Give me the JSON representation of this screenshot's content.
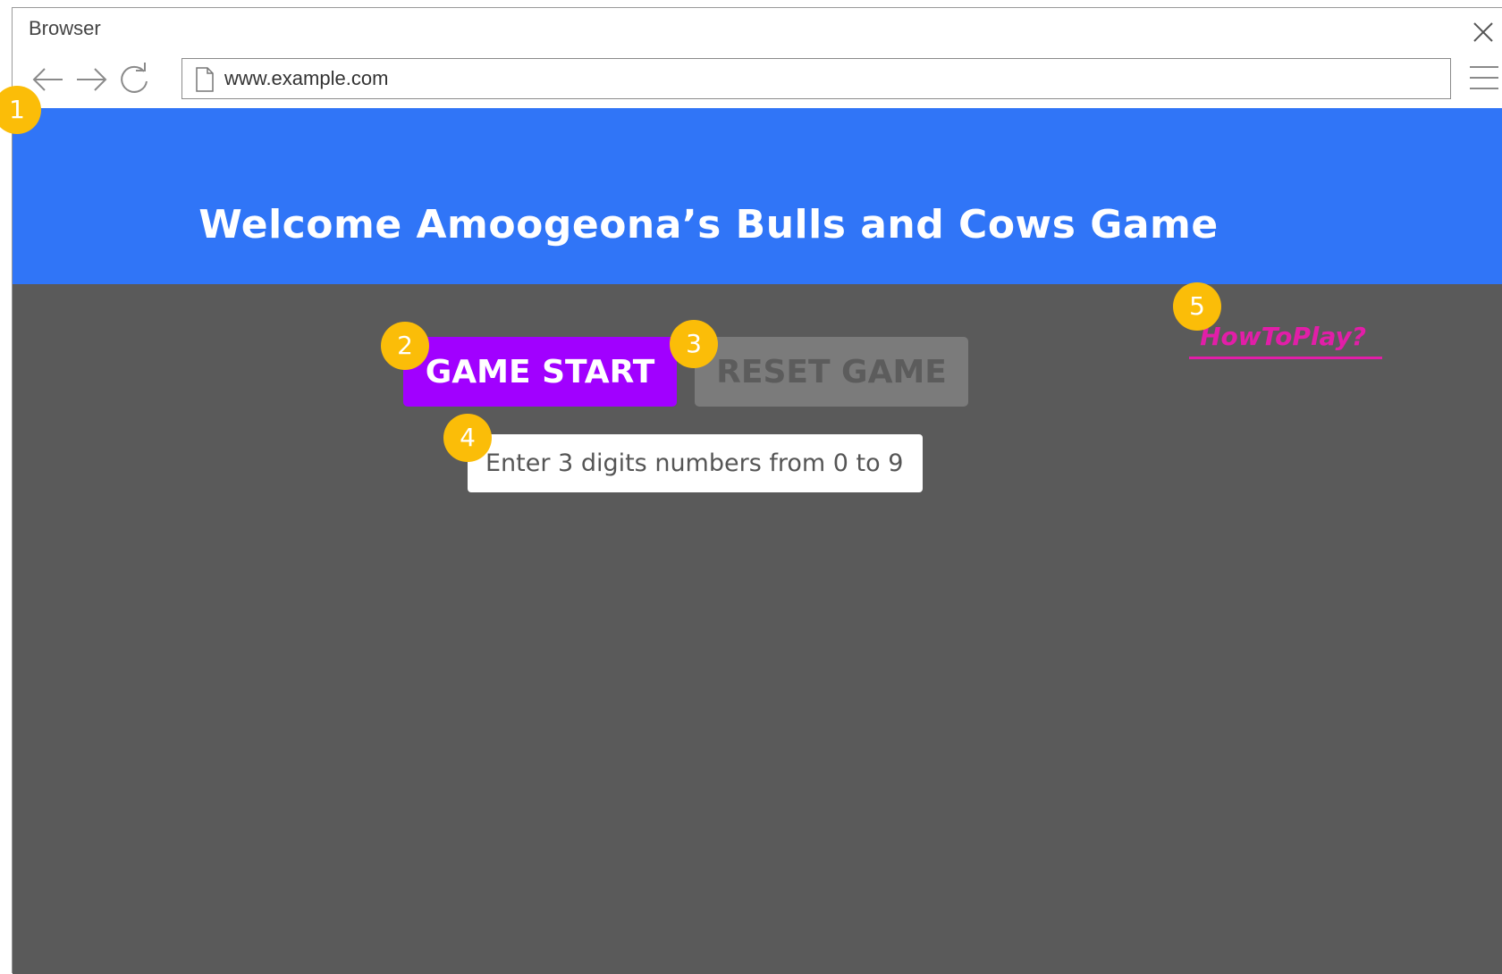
{
  "browser": {
    "title": "Browser",
    "url": "www.example.com",
    "icons": {
      "back": "arrow-left-icon",
      "forward": "arrow-right-icon",
      "reload": "reload-icon",
      "page": "page-icon",
      "close": "close-icon",
      "menu": "hamburger-menu-icon"
    }
  },
  "header": {
    "title": "Welcome Amoogeona’s Bulls and Cows Game",
    "background_color": "#3075f7"
  },
  "main": {
    "background_color": "#5a5a5a",
    "start_button": {
      "label": "GAME START",
      "color": "#a100ff"
    },
    "reset_button": {
      "label": "RESET GAME",
      "color": "#7b7b7b"
    },
    "number_input": {
      "value": "",
      "placeholder": "Enter 3 digits numbers from 0 to 9"
    },
    "how_to_play": {
      "label": "HowToPlay?",
      "color": "#e21ea8"
    }
  },
  "annotations": {
    "color": "#fbbd08",
    "markers": [
      "1",
      "2",
      "3",
      "4",
      "5"
    ]
  }
}
